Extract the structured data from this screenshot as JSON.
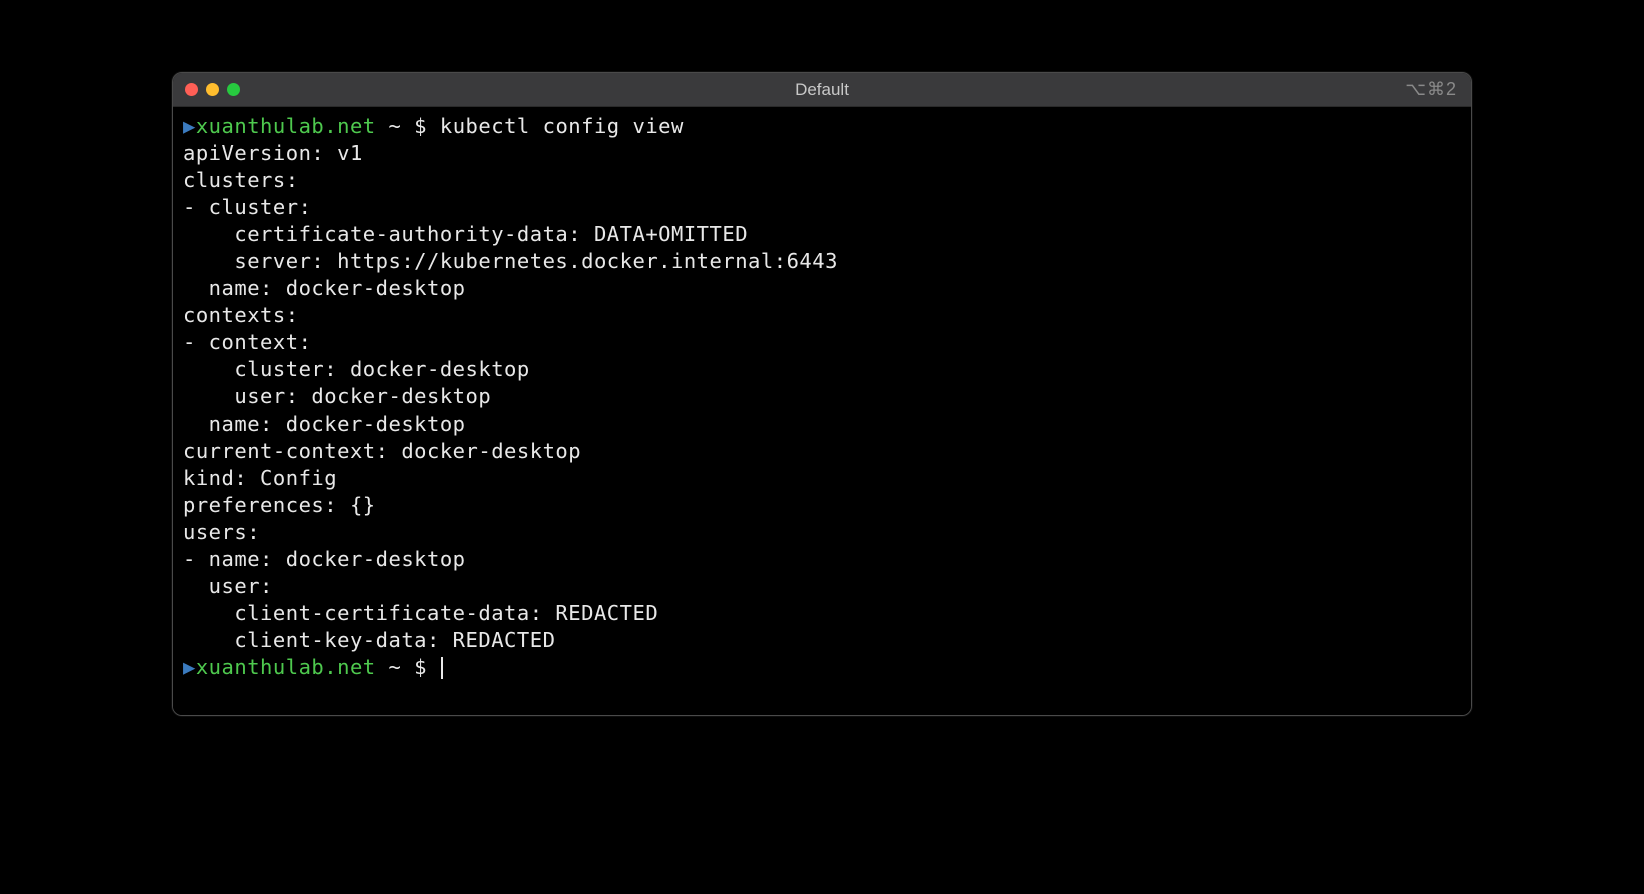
{
  "window": {
    "title": "Default",
    "shortcut": "⌥⌘2"
  },
  "prompt": {
    "marker": "▶",
    "host": "xuanthulab.net",
    "path": " ~ $ "
  },
  "command": "kubectl config view",
  "output": {
    "lines": [
      "apiVersion: v1",
      "clusters:",
      "- cluster:",
      "    certificate-authority-data: DATA+OMITTED",
      "    server: https://kubernetes.docker.internal:6443",
      "  name: docker-desktop",
      "contexts:",
      "- context:",
      "    cluster: docker-desktop",
      "    user: docker-desktop",
      "  name: docker-desktop",
      "current-context: docker-desktop",
      "kind: Config",
      "preferences: {}",
      "users:",
      "- name: docker-desktop",
      "  user:",
      "    client-certificate-data: REDACTED",
      "    client-key-data: REDACTED"
    ]
  }
}
